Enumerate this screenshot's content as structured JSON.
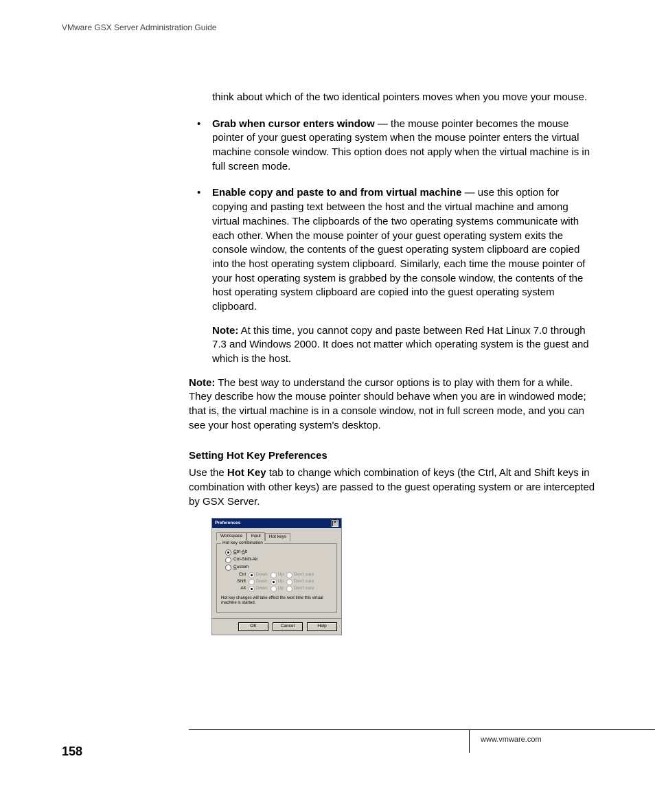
{
  "header": {
    "running": "VMware GSX Server Administration Guide"
  },
  "content": {
    "intro_tail": "think about which of the two identical pointers moves when you move your mouse.",
    "bullets": [
      {
        "lead": "Grab when cursor enters window",
        "text": " — the mouse pointer becomes the mouse pointer of your guest operating system when the mouse pointer enters the virtual machine console window. This option does not apply when the virtual machine is in full screen mode."
      },
      {
        "lead": "Enable copy and paste to and from virtual machine",
        "text": " — use this option for copying and pasting text between the host and the virtual machine and among virtual machines. The clipboards of the two operating systems communicate with each other. When the mouse pointer of your guest operating system exits the console window, the contents of the guest operating system clipboard are copied into the host operating system clipboard. Similarly, each time the mouse pointer of your host operating system is grabbed by the console window, the contents of the host operating system clipboard are copied into the guest operating system clipboard."
      }
    ],
    "inner_note_label": "Note:",
    "inner_note": "   At this time, you cannot copy and paste between Red Hat Linux 7.0 through 7.3 and Windows 2000. It does not matter which operating system is the guest and which is the host.",
    "outer_note_label": "Note:",
    "outer_note": "   The best way to understand the cursor options is to play with them for a while. They describe how the mouse pointer should behave when you are in windowed mode; that is, the virtual machine is in a console window, not in full screen mode, and you can see your host operating system's desktop.",
    "section_head": "Setting Hot Key Preferences",
    "section_p_a": "Use the ",
    "section_p_b": "Hot Key",
    "section_p_c": " tab to change which combination of keys (the Ctrl, Alt and Shift keys in combination with other keys) are passed to the guest operating system or are intercepted by GSX Server."
  },
  "dialog": {
    "title": "Preferences",
    "tabs": [
      "Workspace",
      "Input",
      "Hot keys"
    ],
    "group": "Hot key combination",
    "opts": [
      "Ctrl-Alt",
      "Ctrl-Shift-Alt",
      "Custom"
    ],
    "grid_rows": [
      "Ctrl",
      "Shift",
      "Alt"
    ],
    "grid_cols": [
      "Down",
      "Up",
      "Don't care"
    ],
    "note": "Hot key changes will take effect the next time this virtual machine is started.",
    "buttons": [
      "OK",
      "Cancel",
      "Help"
    ]
  },
  "footer": {
    "url": "www.vmware.com",
    "page": "158"
  }
}
